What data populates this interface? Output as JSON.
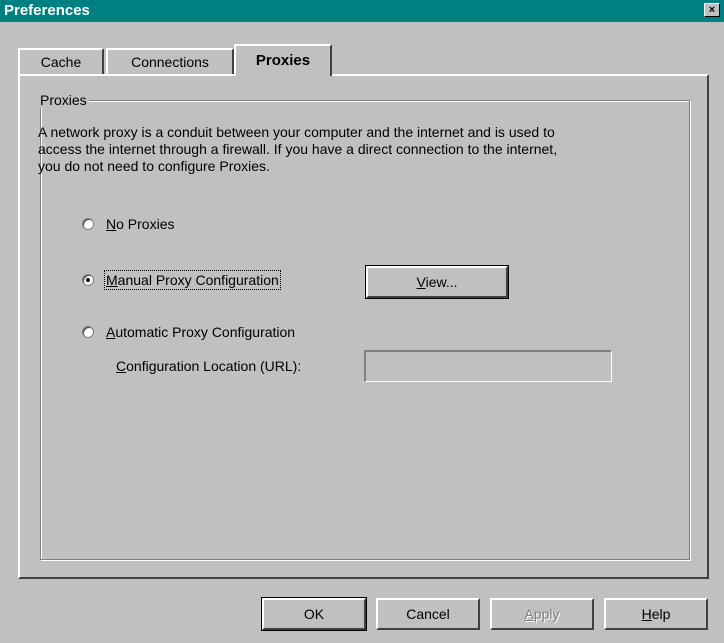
{
  "window": {
    "title": "Preferences",
    "close_glyph": "×"
  },
  "tabs": [
    {
      "label": "Cache",
      "active": false
    },
    {
      "label": "Connections",
      "active": false
    },
    {
      "label": "Proxies",
      "active": true
    }
  ],
  "proxies": {
    "group_label": "Proxies",
    "description_lines": [
      "A network proxy is a conduit between your computer and the internet and is used to",
      "access the internet through a firewall.  If you have a direct connection to the internet,",
      "you do not need to configure Proxies."
    ],
    "options": [
      {
        "mnemonic": "N",
        "rest": "o Proxies",
        "checked": false
      },
      {
        "mnemonic": "M",
        "rest": "anual Proxy Configuration",
        "checked": true
      },
      {
        "mnemonic": "A",
        "rest": "utomatic Proxy Configuration",
        "checked": false
      }
    ],
    "view_button": {
      "mnemonic": "V",
      "rest": "iew..."
    },
    "config_location": {
      "label_mnemonic": "C",
      "label_rest": "onfiguration Location (URL):",
      "value": ""
    }
  },
  "footer": {
    "ok": "OK",
    "cancel": "Cancel",
    "apply_mnemonic": "A",
    "apply_rest": "pply",
    "help_mnemonic": "H",
    "help_rest": "elp"
  }
}
